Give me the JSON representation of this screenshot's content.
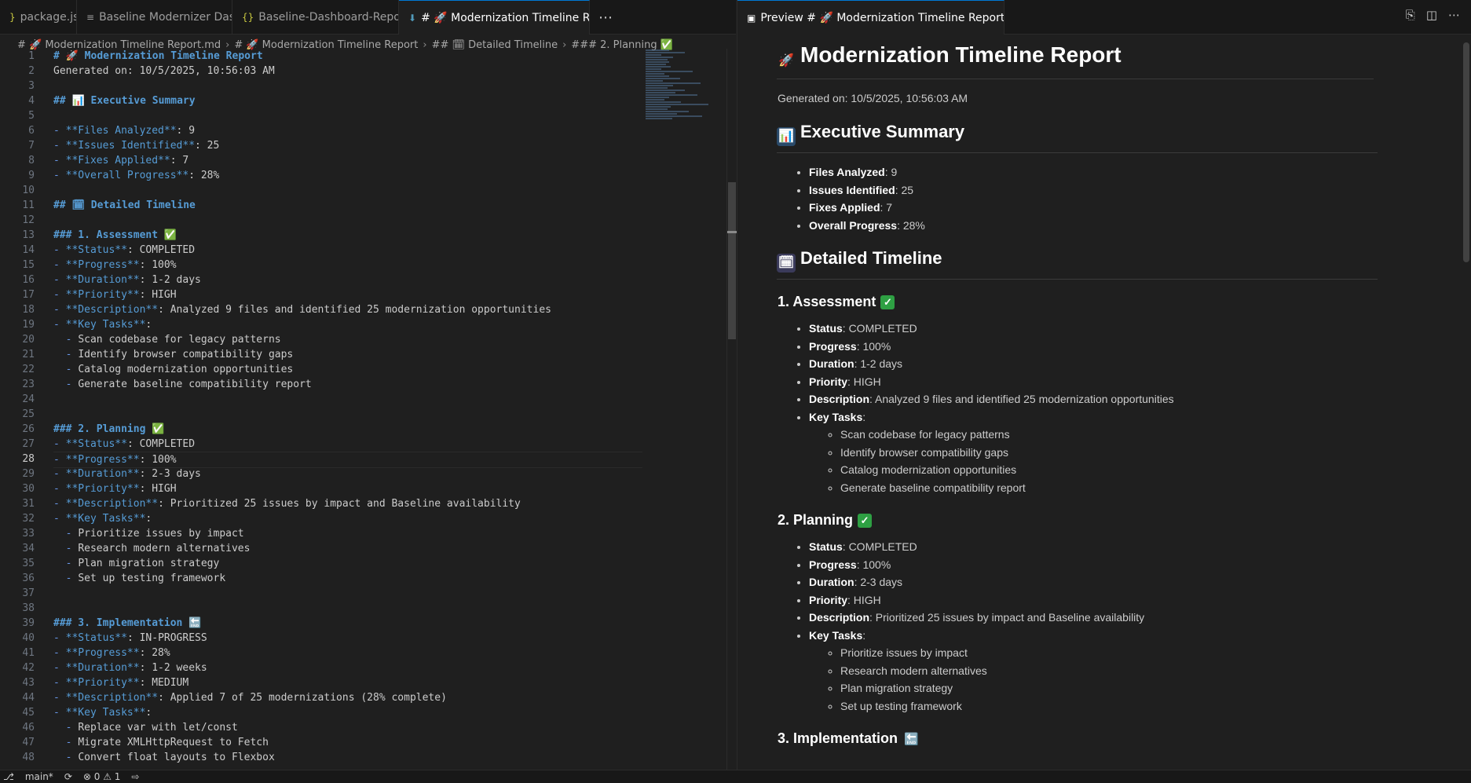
{
  "left_tabs": [
    {
      "icon": "}",
      "label": "package.json"
    },
    {
      "icon": "≡",
      "label": "Baseline Modernizer Dashboard"
    },
    {
      "icon": "{}",
      "label": "Baseline-Dashboard-Report.json"
    },
    {
      "icon": "⬇",
      "label": "# 🚀 Modernization Timeline Report.md",
      "active": true
    }
  ],
  "right_tab": {
    "label": "Preview # 🚀 Modernization Timeline Report.md"
  },
  "breadcrumb": [
    "# 🚀 Modernization Timeline Report.md",
    "# 🚀 Modernization Timeline Report",
    "## 🗓 Detailed Timeline",
    "### 2. Planning ✅"
  ],
  "editor_lines": [
    "# 🚀 Modernization Timeline Report",
    "Generated on: 10/5/2025, 10:56:03 AM",
    "",
    "## 📊 Executive Summary",
    "",
    "- **Files Analyzed**: 9",
    "- **Issues Identified**: 25",
    "- **Fixes Applied**: 7",
    "- **Overall Progress**: 28%",
    "",
    "## 🗓 Detailed Timeline",
    "",
    "### 1. Assessment ✅",
    "- **Status**: COMPLETED",
    "- **Progress**: 100%",
    "- **Duration**: 1-2 days",
    "- **Priority**: HIGH",
    "- **Description**: Analyzed 9 files and identified 25 modernization opportunities",
    "- **Key Tasks**:",
    "  - Scan codebase for legacy patterns",
    "  - Identify browser compatibility gaps",
    "  - Catalog modernization opportunities",
    "  - Generate baseline compatibility report",
    "",
    "",
    "### 2. Planning ✅",
    "- **Status**: COMPLETED",
    "- **Progress**: 100%",
    "- **Duration**: 2-3 days",
    "- **Priority**: HIGH",
    "- **Description**: Prioritized 25 issues by impact and Baseline availability",
    "- **Key Tasks**:",
    "  - Prioritize issues by impact",
    "  - Research modern alternatives",
    "  - Plan migration strategy",
    "  - Set up testing framework",
    "",
    "",
    "### 3. Implementation 🔚",
    "- **Status**: IN-PROGRESS",
    "- **Progress**: 28%",
    "- **Duration**: 1-2 weeks",
    "- **Priority**: MEDIUM",
    "- **Description**: Applied 7 of 25 modernizations (28% complete)",
    "- **Key Tasks**:",
    "  - Replace var with let/const",
    "  - Migrate XMLHttpRequest to Fetch",
    "  - Convert float layouts to Flexbox"
  ],
  "current_line": 28,
  "preview": {
    "title": "Modernization Timeline Report",
    "generated": "Generated on: 10/5/2025, 10:56:03 AM",
    "summary_heading": "Executive Summary",
    "summary": [
      {
        "k": "Files Analyzed",
        "v": ": 9"
      },
      {
        "k": "Issues Identified",
        "v": ": 25"
      },
      {
        "k": "Fixes Applied",
        "v": ": 7"
      },
      {
        "k": "Overall Progress",
        "v": ": 28%"
      }
    ],
    "timeline_heading": "Detailed Timeline",
    "phases": [
      {
        "title": "1. Assessment",
        "done": true,
        "items": [
          {
            "k": "Status",
            "v": ": COMPLETED"
          },
          {
            "k": "Progress",
            "v": ": 100%"
          },
          {
            "k": "Duration",
            "v": ": 1-2 days"
          },
          {
            "k": "Priority",
            "v": ": HIGH"
          },
          {
            "k": "Description",
            "v": ": Analyzed 9 files and identified 25 modernization opportunities"
          },
          {
            "k": "Key Tasks",
            "v": ":"
          }
        ],
        "tasks": [
          "Scan codebase for legacy patterns",
          "Identify browser compatibility gaps",
          "Catalog modernization opportunities",
          "Generate baseline compatibility report"
        ]
      },
      {
        "title": "2. Planning",
        "done": true,
        "items": [
          {
            "k": "Status",
            "v": ": COMPLETED"
          },
          {
            "k": "Progress",
            "v": ": 100%"
          },
          {
            "k": "Duration",
            "v": ": 2-3 days"
          },
          {
            "k": "Priority",
            "v": ": HIGH"
          },
          {
            "k": "Description",
            "v": ": Prioritized 25 issues by impact and Baseline availability"
          },
          {
            "k": "Key Tasks",
            "v": ":"
          }
        ],
        "tasks": [
          "Prioritize issues by impact",
          "Research modern alternatives",
          "Plan migration strategy",
          "Set up testing framework"
        ]
      },
      {
        "title": "3. Implementation",
        "done": false,
        "items": [],
        "tasks": []
      }
    ]
  },
  "status": {
    "branch": "main*",
    "problems": "⊗ 0 ⚠ 1"
  }
}
